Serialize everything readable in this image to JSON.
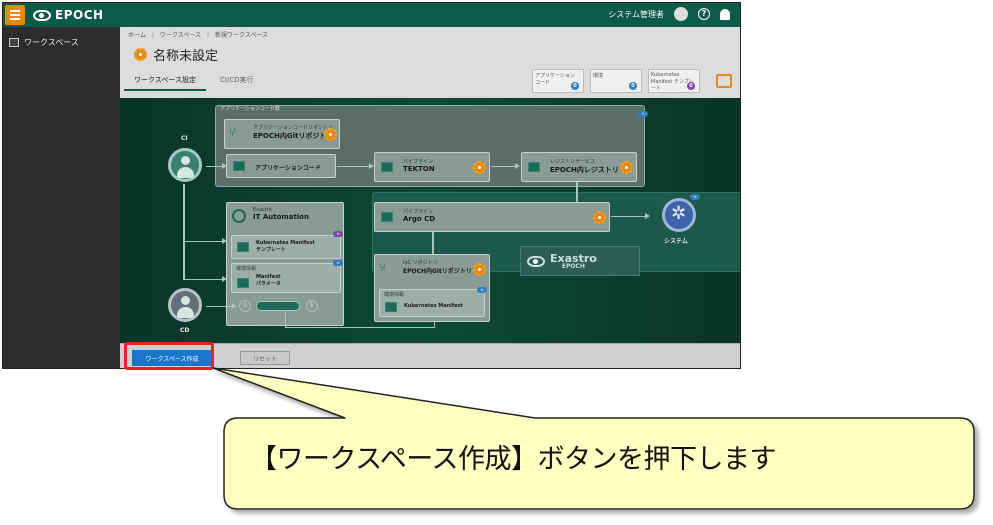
{
  "app": {
    "brand": "EPOCH"
  },
  "topbar": {
    "user": "システム管理者",
    "help_glyph": "?"
  },
  "sidebar": {
    "items": [
      {
        "label": "ワークスペース"
      }
    ]
  },
  "breadcrumb": [
    "ホーム",
    "ワークスペース",
    "新規ワークスペース"
  ],
  "page": {
    "title": "名称未設定"
  },
  "tabs": [
    {
      "label": "ワークスペース設定",
      "active": true
    },
    {
      "label": "CI/CD実行",
      "active": false
    }
  ],
  "counts": [
    {
      "label": "アプリケーション コード",
      "value": "0"
    },
    {
      "label": "環境",
      "value": "0"
    },
    {
      "label": "Kubernetes Manifest テンプレート",
      "value": "0"
    }
  ],
  "diagram": {
    "group_app": "アプリケーションコード群",
    "ci_label": "CI",
    "cd_label": "CD",
    "system_label": "システム",
    "app_repo": {
      "sub": "アプリケーションコードリポジトリ",
      "title": "EPOCH内Gitリポジトリ"
    },
    "app_code": "アプリケーションコード",
    "pipeline_tekton": {
      "sub": "パイプライン",
      "title": "TEKTON"
    },
    "registry": {
      "sub": "レジストリサービス",
      "title": "EPOCH内レジストリ"
    },
    "ita": {
      "sub": "Exastro",
      "title": "IT Automation"
    },
    "manifest_template": {
      "title": "Kubernetes Manifest",
      "sub": "テンプレート"
    },
    "env_label": "環境情報",
    "manifest_param": {
      "title": "Manifest",
      "sub": "パラメータ"
    },
    "pipeline_argo": {
      "sub": "パイプライン",
      "title": "Argo CD"
    },
    "iac_repo": {
      "sub": "IaC リポジトリ",
      "title": "EPOCH内Gitリポジトリ"
    },
    "env_label2": "環境情報",
    "k8s_manifest": "Kubernetes Manifest",
    "logo_main": "Exastro",
    "logo_sub": "EPOCH",
    "s_label": "S",
    "e_label": "E"
  },
  "bottom": {
    "create_button": "ワークスペース作成",
    "reset_button": "リセット"
  },
  "callout": {
    "text": "【ワークスペース作成】ボタンを押下します"
  }
}
